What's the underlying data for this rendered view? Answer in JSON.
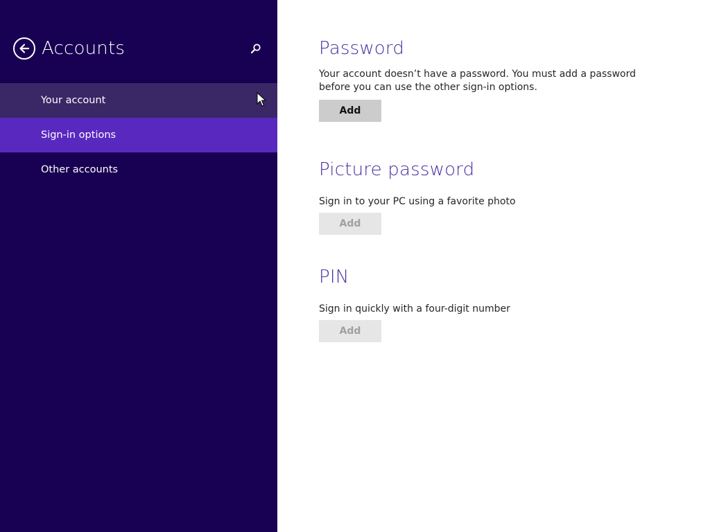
{
  "sidebar": {
    "title": "Accounts",
    "back_icon": "back-arrow-icon",
    "search_icon": "search-icon",
    "items": [
      {
        "label": "Your account",
        "state": "hover"
      },
      {
        "label": "Sign-in options",
        "state": "selected"
      },
      {
        "label": "Other accounts",
        "state": "normal"
      }
    ]
  },
  "main": {
    "sections": [
      {
        "title": "Password",
        "description": "Your account doesn’t have a password. You must add a password before you can use the other sign-in options.",
        "button_label": "Add",
        "button_enabled": true
      },
      {
        "title": "Picture password",
        "description": "Sign in to your PC using a favorite photo",
        "button_label": "Add",
        "button_enabled": false
      },
      {
        "title": "PIN",
        "description": "Sign in quickly with a four-digit number",
        "button_label": "Add",
        "button_enabled": false
      }
    ]
  },
  "colors": {
    "sidebar_bg": "#180052",
    "selected_bg": "#5929bf",
    "hover_bg": "#3a2766",
    "title_color": "#4a2ea0"
  }
}
